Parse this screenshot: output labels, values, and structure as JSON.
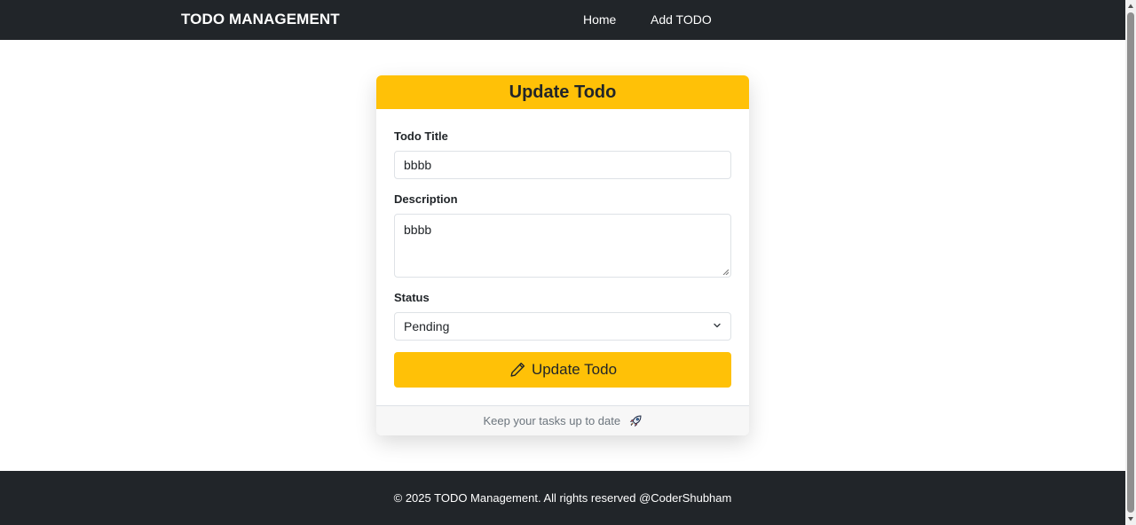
{
  "navbar": {
    "brand": "TODO MANAGEMENT",
    "links": [
      "Home",
      "Add TODO"
    ]
  },
  "card": {
    "header": "Update Todo",
    "fields": {
      "title_label": "Todo Title",
      "title_value": "bbbb",
      "description_label": "Description",
      "description_value": "bbbb",
      "status_label": "Status",
      "status_value": "Pending"
    },
    "button_label": "Update Todo",
    "footer_text": "Keep your tasks up to date"
  },
  "footer": {
    "text": "© 2025 TODO Management. All rights reserved @CoderShubham"
  },
  "icons": {
    "button": "pencil-icon",
    "footer": "rocket-icon",
    "select": "chevron-down-icon"
  },
  "colors": {
    "navbar": "#212529",
    "accent": "#ffc107",
    "footer": "#212529",
    "muted_text": "#6c757d"
  }
}
